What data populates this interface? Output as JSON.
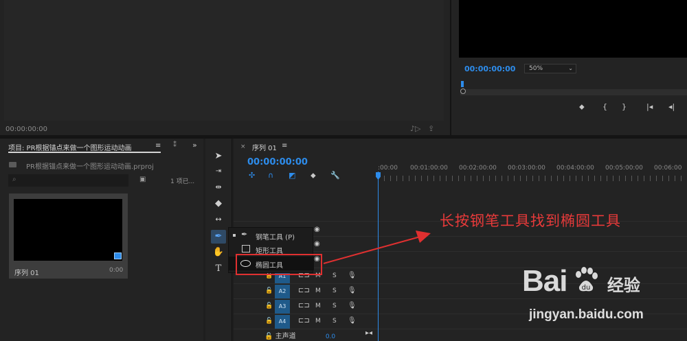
{
  "source_monitor": {
    "timecode": "00:00:00:00"
  },
  "program_monitor": {
    "timecode": "00:00:00:00",
    "zoom": "50%"
  },
  "project": {
    "tab_label": "项目: PR根据锚点来做一个图形运动动画",
    "file_name": "PR根据锚点来做一个图形运动动画.prproj",
    "count": "1 项已...",
    "thumb_name": "序列 01",
    "thumb_duration": "0:00"
  },
  "timeline": {
    "sequence_tab": "序列 01",
    "timecode": "00:00:00:00",
    "ruler": [
      ":00:00",
      "00:01:00:00",
      "00:02:00:00",
      "00:03:00:00",
      "00:04:00:00",
      "00:05:00:00",
      "00:06:00"
    ],
    "audio_tracks": [
      {
        "label": "A1",
        "m": "M",
        "s": "S"
      },
      {
        "label": "A2",
        "m": "M",
        "s": "S"
      },
      {
        "label": "A3",
        "m": "M",
        "s": "S"
      },
      {
        "label": "A4",
        "m": "M",
        "s": "S"
      }
    ],
    "master_label": "主声道",
    "master_value": "0.0"
  },
  "tool_popup": {
    "items": [
      {
        "label": "钢笔工具 (P)"
      },
      {
        "label": "矩形工具"
      },
      {
        "label": "椭圆工具"
      }
    ]
  },
  "annotation": "长按钢笔工具找到椭圆工具",
  "watermark": {
    "logo": "Bai",
    "logo_jy": "经验",
    "url": "jingyan.baidu.com"
  },
  "colors": {
    "accent": "#2d8ceb",
    "annotation": "#e83a3a"
  }
}
